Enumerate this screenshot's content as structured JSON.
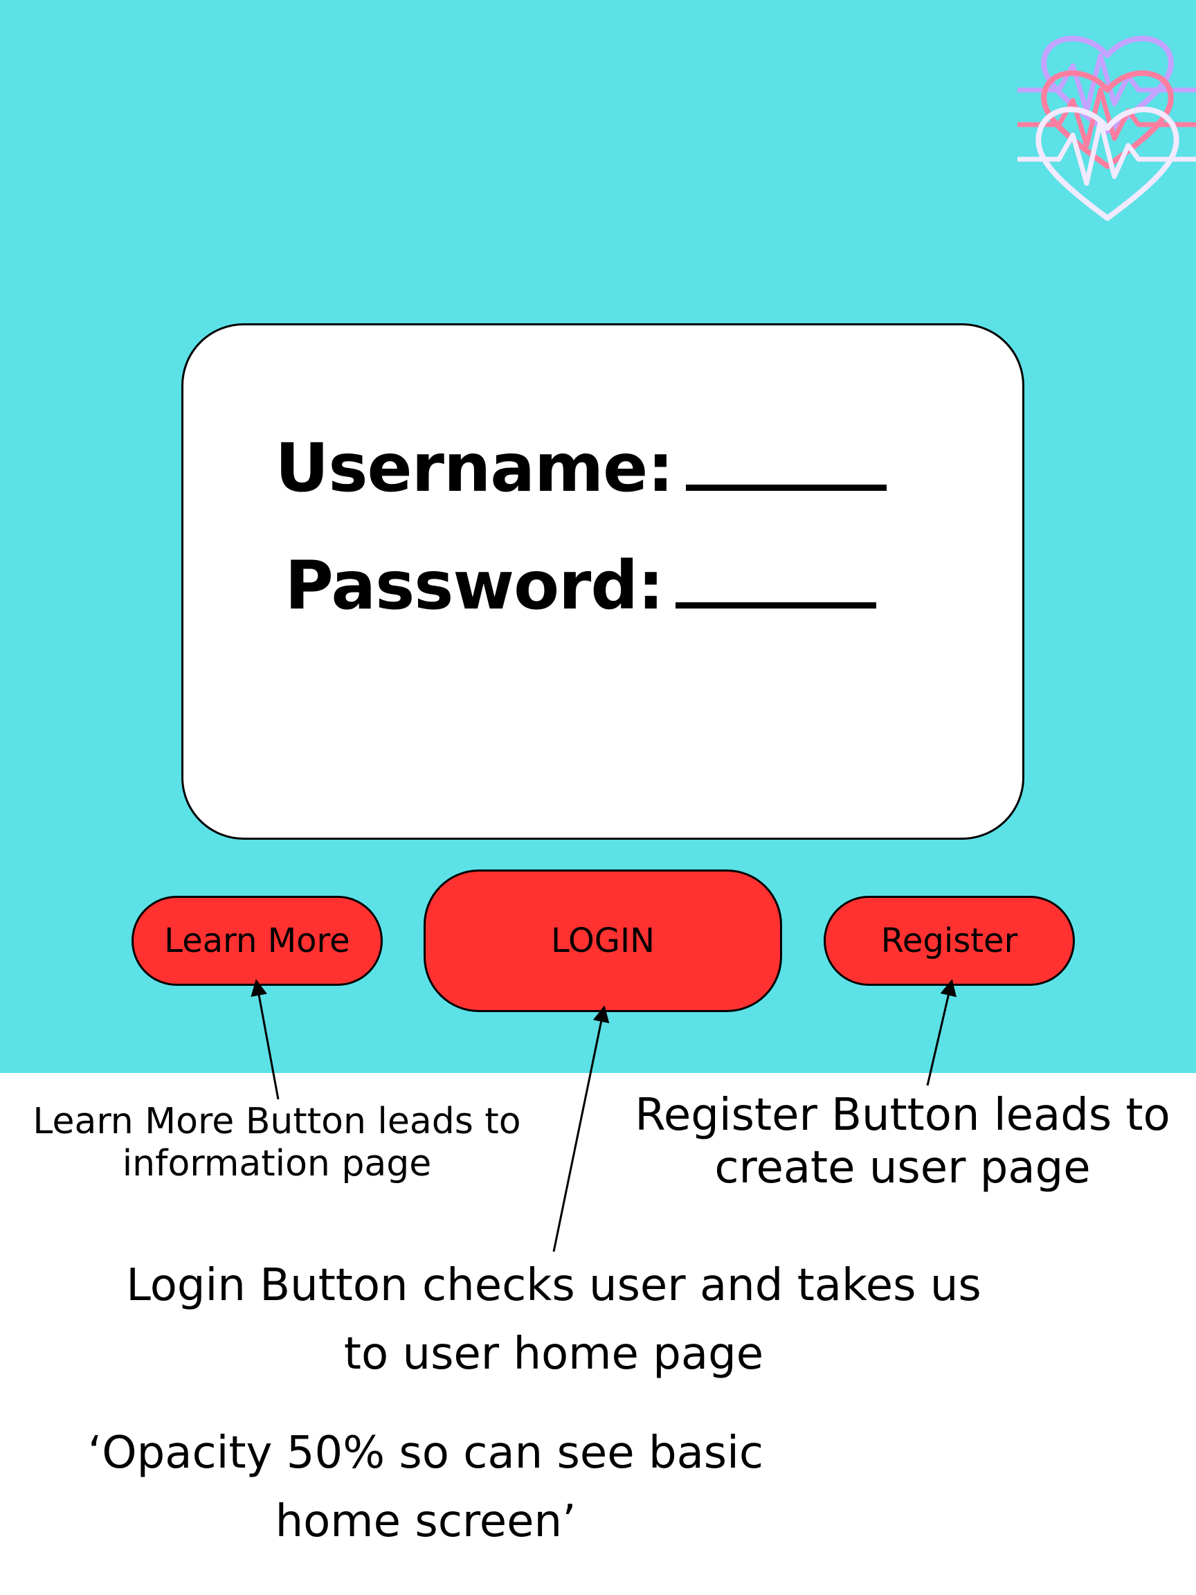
{
  "login_form": {
    "username_label": "Username:",
    "password_label": "Password:"
  },
  "buttons": {
    "learn_more": "Learn More",
    "login": "LOGIN",
    "register": "Register"
  },
  "annotations": {
    "learn_more_note": [
      "Learn More Button leads to",
      "information page"
    ],
    "register_note": [
      "Register Button leads to",
      "create user page"
    ],
    "login_note": [
      "Login Button checks user and takes us",
      "to user home page"
    ],
    "opacity_note": [
      "‘Opacity 50% so can see basic",
      "home screen’"
    ]
  },
  "colors": {
    "background": "#5ce1e6",
    "card": "#ffffff",
    "button": "#ff3131",
    "logo_purple": "#c4a2ff",
    "logo_pink": "#ff7ea0",
    "logo_white": "#f2eaff"
  },
  "icons": {
    "logo": "heartbeat-hearts-icon"
  }
}
